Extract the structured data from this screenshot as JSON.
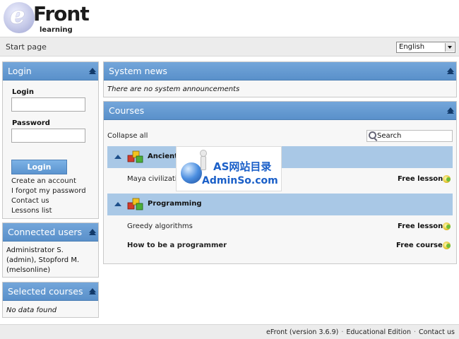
{
  "header": {
    "logo_e": "e",
    "logo_front": "Front",
    "logo_learning": "learning"
  },
  "pathbar": {
    "start_page": "Start page",
    "language": "English"
  },
  "login": {
    "title": "Login",
    "login_label": "Login",
    "password_label": "Password",
    "button": "Login",
    "links": [
      "Create an account",
      "I forgot my password",
      "Contact us",
      "Lessons list"
    ]
  },
  "connected_users": {
    "title": "Connected users",
    "text": "Administrator S. (admin), Stopford M. (melsonline)"
  },
  "selected_courses": {
    "title": "Selected courses",
    "empty": "No data found"
  },
  "system_news": {
    "title": "System news",
    "text": "There are no system announcements"
  },
  "courses": {
    "title": "Courses",
    "collapse_all": "Collapse all",
    "search": "Search",
    "categories": [
      {
        "name": "Ancient",
        "lessons": [
          {
            "name": "Maya civilization",
            "price": "Free lesson"
          }
        ]
      },
      {
        "name": "Programming",
        "lessons": [
          {
            "name": "Greedy algorithms",
            "price": "Free lesson"
          },
          {
            "name": "How to be a programmer",
            "price": "Free course"
          }
        ]
      }
    ]
  },
  "watermark": {
    "line1": "AS网站目录",
    "line2": "AdminSo.com"
  },
  "footer": {
    "version": "eFront (version 3.6.9)",
    "edition": "Educational Edition",
    "contact": "Contact us"
  }
}
